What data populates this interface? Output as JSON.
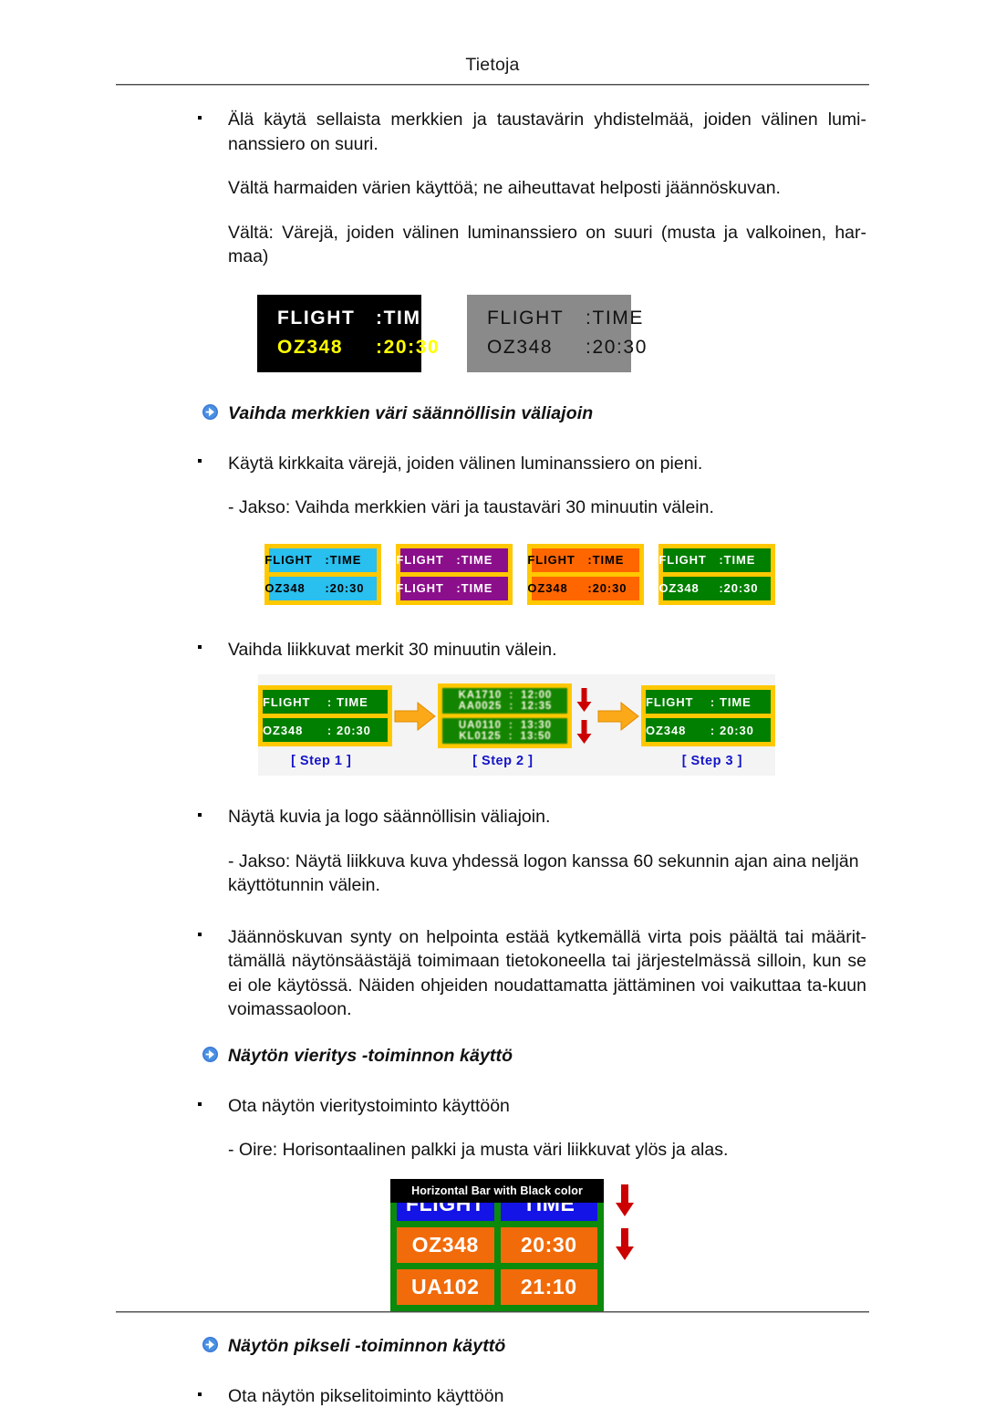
{
  "header": {
    "title": "Tietoja"
  },
  "colors": {
    "gold_border": "#FFC800",
    "cyan": "#29BFEE",
    "purple": "#8B0F8B",
    "orange": "#FF6600",
    "green": "#007F00",
    "black": "#000000",
    "gray": "#8A8A8A",
    "yellow_text": "#FFFF00",
    "step_label_blue": "#1414C8",
    "arrow_orange": "#FBA919",
    "red_arrow": "#CC0000",
    "hbar_green": "#0B8A0B",
    "hbar_blue": "#1414E6",
    "hbar_orange": "#F26B0A"
  },
  "body": {
    "bullet1": "Älä käytä sellaista merkkien ja taustavärin yhdistelmää, joiden välinen lumi-nanssiero on suuri.",
    "para1": "Vältä harmaiden värien käyttöä; ne aiheuttavat helposti jäännöskuvan.",
    "para2": "Vältä: Värejä, joiden välinen luminanssiero on suuri (musta ja valkoinen, har-maa)",
    "heading1": "Vaihda merkkien väri säännöllisin väliajoin",
    "bullet2": "Käytä kirkkaita värejä, joiden välinen luminanssiero on pieni.",
    "note1": "- Jakso: Vaihda merkkien väri ja taustaväri 30 minuutin välein.",
    "bullet3": "Vaihda liikkuvat merkit 30 minuutin välein.",
    "bullet4": "Näytä kuvia ja logo säännöllisin väliajoin.",
    "note2": "- Jakso: Näytä liikkuva kuva yhdessä logon kanssa 60 sekunnin ajan aina neljän käyttötunnin välein.",
    "bullet5": "Jäännöskuvan synty on helpointa estää kytkemällä virta pois päältä tai määrit-tämällä näytönsäästäjä toimimaan tietokoneella tai järjestelmässä silloin, kun se ei ole käytössä. Näiden ohjeiden noudattamatta jättäminen voi vaikuttaa ta-kuun voimassaoloon.",
    "heading2": "Näytön vieritys -toiminnon käyttö",
    "bullet6": "Ota näytön vieritystoiminto käyttöön",
    "note3": "- Oire: Horisontaalinen palkki ja musta väri liikkuvat ylös ja alas.",
    "heading3": "Näytön pikseli -toiminnon käyttö",
    "bullet7": "Ota näytön pikselitoiminto käyttöön"
  },
  "figure_contrast": {
    "panels": [
      {
        "name": "black-panel",
        "bg": "#000000",
        "line1": {
          "a": "FLIGHT",
          "sep": ":",
          "b": "TIME",
          "color": "#FFFFFF"
        },
        "line2": {
          "a": "OZ348",
          "sep": ":",
          "b": "20:30",
          "color": "#FFFF00"
        }
      },
      {
        "name": "gray-panel",
        "bg": "#8A8A8A",
        "line1": {
          "a": "FLIGHT",
          "sep": ":",
          "b": "TIME",
          "color": "#111111"
        },
        "line2": {
          "a": "OZ348",
          "sep": ":",
          "b": "20:30",
          "color": "#111111"
        }
      }
    ]
  },
  "figure_colors": {
    "panels": [
      {
        "name": "cyan-panel",
        "bg": "#29BFEE",
        "text": "#000000",
        "row1": {
          "a": "FLIGHT",
          "sep": ":",
          "b": "TIME"
        },
        "row2": {
          "a": "OZ348",
          "sep": ":",
          "b": "20:30"
        }
      },
      {
        "name": "purple-panel",
        "bg": "#8B0F8B",
        "text": "#FFFFFF",
        "row1": {
          "a": "FLIGHT",
          "sep": ":",
          "b": "TIME"
        },
        "row2": {
          "a": "FLIGHT",
          "sep": ":",
          "b": "TIME"
        }
      },
      {
        "name": "orange-panel",
        "bg": "#FF6600",
        "text": "#000000",
        "row1": {
          "a": "FLIGHT",
          "sep": ":",
          "b": "TIME"
        },
        "row2": {
          "a": "OZ348",
          "sep": ":",
          "b": "20:30"
        }
      },
      {
        "name": "green-panel",
        "bg": "#007F00",
        "text": "#FFFFFF",
        "row1": {
          "a": "FLIGHT",
          "sep": ":",
          "b": "TIME"
        },
        "row2": {
          "a": "OZ348",
          "sep": ":",
          "b": "20:30"
        }
      }
    ]
  },
  "figure_steps": {
    "step1": {
      "label": "[ Step 1 ]",
      "bg": "#007F00",
      "text": "#FFFFFF",
      "row1": {
        "a": "FLIGHT",
        "sep": ":",
        "b": "TIME"
      },
      "row2": {
        "a": "OZ348",
        "sep": ":",
        "b": "20:30"
      }
    },
    "step2": {
      "label": "[ Step 2 ]",
      "bg": "#007F00",
      "text": "#FFFFFF",
      "row1_top": "KA1710  :  12:00",
      "row1_bottom": "AA0025  :  12:35",
      "row2_top": "UA0110  :  13:30",
      "row2_bottom": "KL0125  :  13:50"
    },
    "step3": {
      "label": "[ Step 3 ]",
      "bg": "#007F00",
      "text": "#FFFFFF",
      "row1": {
        "a": "FLIGHT",
        "sep": ":",
        "b": "TIME"
      },
      "row2": {
        "a": "OZ348",
        "sep": ":",
        "b": "20:30"
      }
    }
  },
  "figure_hbar": {
    "bar_label": "Horizontal Bar with Black color",
    "rows": [
      {
        "left": "FLIGHT",
        "right": "TIME",
        "style": "blue"
      },
      {
        "left": "OZ348",
        "right": "20:30",
        "style": "orange"
      },
      {
        "left": "UA102",
        "right": "21:10",
        "style": "orange"
      }
    ]
  }
}
